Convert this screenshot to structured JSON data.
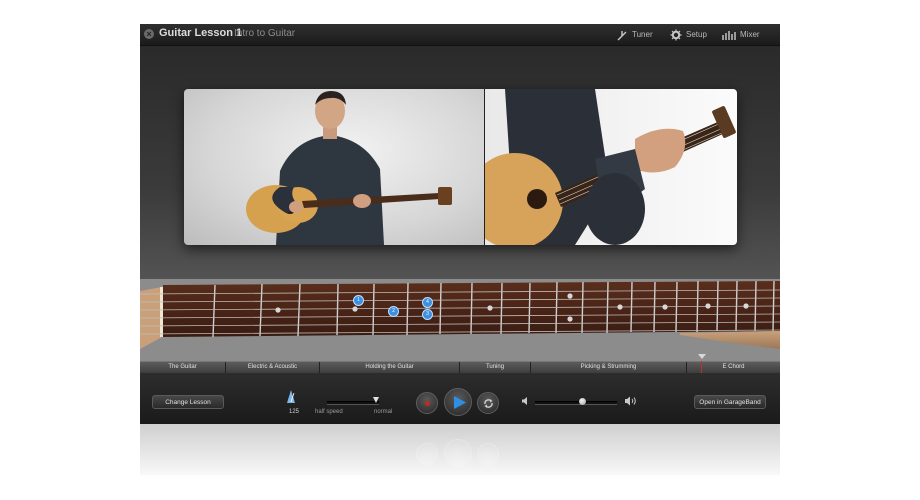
{
  "window": {
    "title": "Guitar Lesson 1",
    "subtitle": "Intro to Guitar",
    "close_icon": "close-icon"
  },
  "toolbar": {
    "tuner_label": "Tuner",
    "setup_label": "Setup",
    "mixer_label": "Mixer"
  },
  "fretboard": {
    "note_markers": [
      "1",
      "2",
      "3",
      "4"
    ]
  },
  "chapters": [
    {
      "label": "The Guitar"
    },
    {
      "label": "Electric & Acoustic"
    },
    {
      "label": "Holding the Guitar"
    },
    {
      "label": "Tuning"
    },
    {
      "label": "Picking & Strumming"
    },
    {
      "label": "E Chord"
    }
  ],
  "controls": {
    "change_lesson_label": "Change Lesson",
    "tempo_value": "125",
    "speed_left_label": "half speed",
    "speed_right_label": "normal",
    "open_garageband_label": "Open in GarageBand",
    "volume_level": 0.58,
    "speed_level": 1.0
  },
  "colors": {
    "accent_play": "#2e8fe6",
    "record": "#c22a22",
    "playhead": "#c0302a"
  }
}
